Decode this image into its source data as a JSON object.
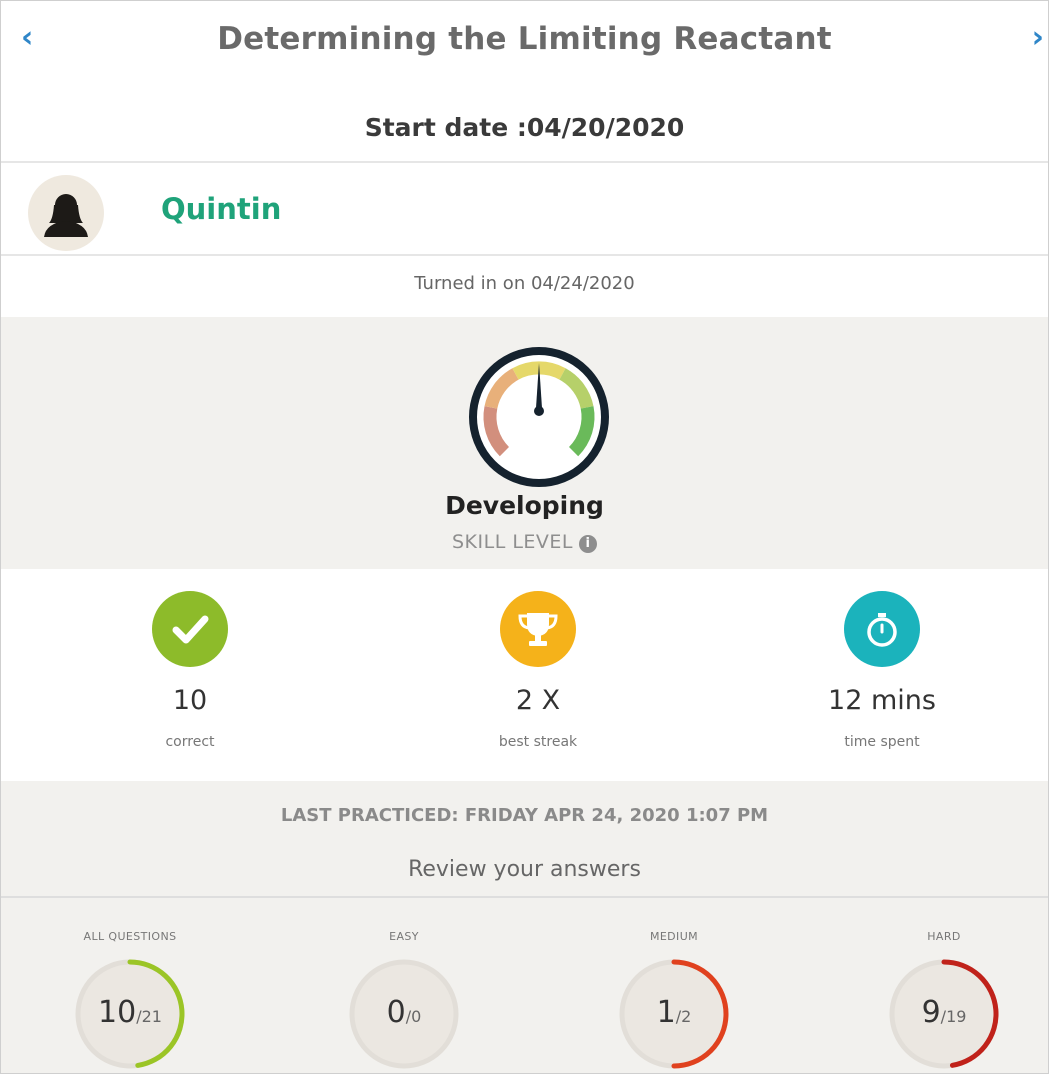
{
  "header": {
    "title": "Determining the Limiting Reactant",
    "prev_icon": "chevron-left-icon",
    "next_icon": "chevron-right-icon",
    "start_date_text": "Start date :04/20/2020"
  },
  "student": {
    "name": "Quintin",
    "avatar_icon": "user-silhouette-icon",
    "name_color": "#1fa37a"
  },
  "submission": {
    "turned_in_text": "Turned in on 04/24/2020"
  },
  "skill": {
    "level": "Developing",
    "label": "SKILL LEVEL",
    "info_icon": "info-icon",
    "gauge_icon": "speedometer-icon"
  },
  "stats": [
    {
      "value": "10",
      "label": "correct",
      "icon": "checkmark-icon",
      "color": "#8dbb2a"
    },
    {
      "value": "2 X",
      "label": "best streak",
      "icon": "trophy-icon",
      "color": "#f5b21a"
    },
    {
      "value": "12 mins",
      "label": "time spent",
      "icon": "stopwatch-icon",
      "color": "#1bb3bc"
    }
  ],
  "practice": {
    "last_practiced": "LAST PRACTICED: FRIDAY APR 24, 2020 1:07 PM",
    "review_link": "Review your answers"
  },
  "buckets": [
    {
      "label": "ALL QUESTIONS",
      "correct": "10",
      "total": "/21",
      "progress": 0.476,
      "color": "#9bc526"
    },
    {
      "label": "EASY",
      "correct": "0",
      "total": "/0",
      "progress": 0,
      "color": "#cccccc"
    },
    {
      "label": "MEDIUM",
      "correct": "1",
      "total": "/2",
      "progress": 0.5,
      "color": "#e0411e"
    },
    {
      "label": "HARD",
      "correct": "9",
      "total": "/19",
      "progress": 0.474,
      "color": "#c0221a"
    }
  ]
}
